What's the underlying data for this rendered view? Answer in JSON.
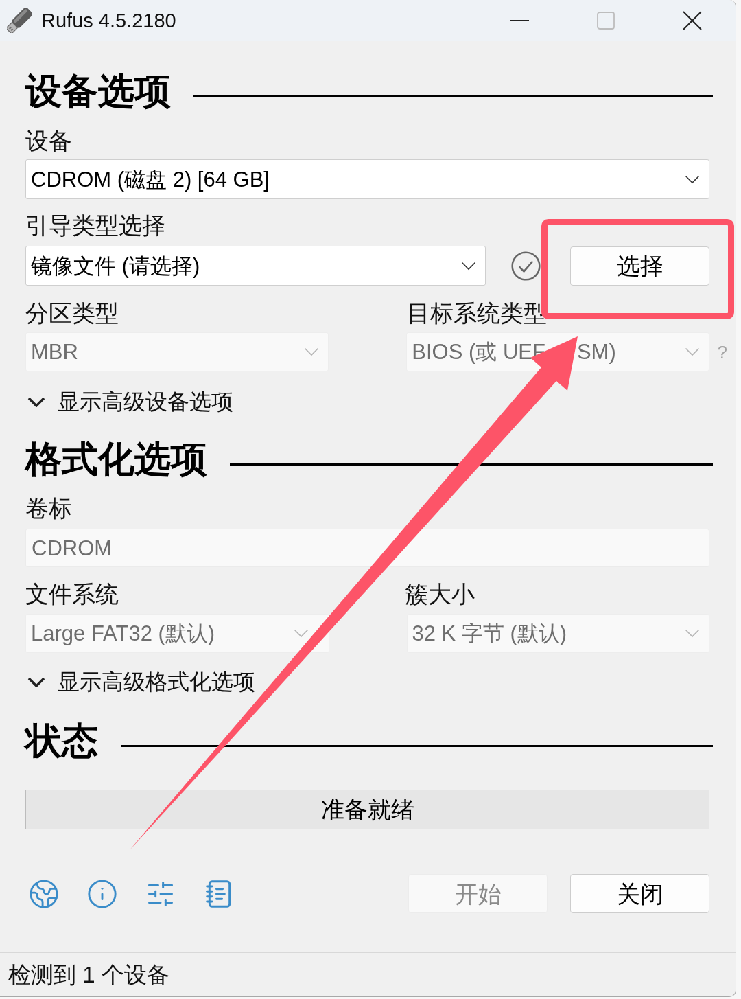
{
  "window": {
    "title": "Rufus 4.5.2180",
    "maximize_disabled": true
  },
  "drive_properties": {
    "heading": "设备选项",
    "device": {
      "label": "设备",
      "value": "CDROM (磁盘 2) [64 GB]",
      "disabled": false
    },
    "boot_selection": {
      "label": "引导类型选择",
      "value": "镜像文件 (请选择)",
      "disabled": false,
      "button": {
        "label": "选择",
        "disabled": false
      }
    },
    "partition_scheme": {
      "label": "分区类型",
      "value": "MBR",
      "disabled": true
    },
    "target_system": {
      "label": "目标系统类型",
      "value_fragments": [
        "BIOS (或 UEF",
        "SM)"
      ],
      "disabled": true,
      "help": "?"
    },
    "advanced_toggle": {
      "label": "显示高级设备选项",
      "expanded": false
    }
  },
  "format_options": {
    "heading": "格式化选项",
    "volume_label": {
      "label": "卷标",
      "value": "CDROM",
      "disabled": true
    },
    "file_system": {
      "label": "文件系统",
      "value": "Large FAT32 (默认)",
      "disabled": true
    },
    "cluster_size": {
      "label": "簇大小",
      "value": "32 K 字节 (默认)",
      "disabled": true
    },
    "advanced_toggle": {
      "label": "显示高级格式化选项",
      "expanded": false
    }
  },
  "status": {
    "heading": "状态",
    "progress_text": "准备就绪",
    "level": 0
  },
  "actions": [
    {
      "label": "开始",
      "disabled": true
    },
    {
      "label": "关闭",
      "disabled": false
    }
  ],
  "status_bar": {
    "text": "检测到 1 个设备"
  }
}
